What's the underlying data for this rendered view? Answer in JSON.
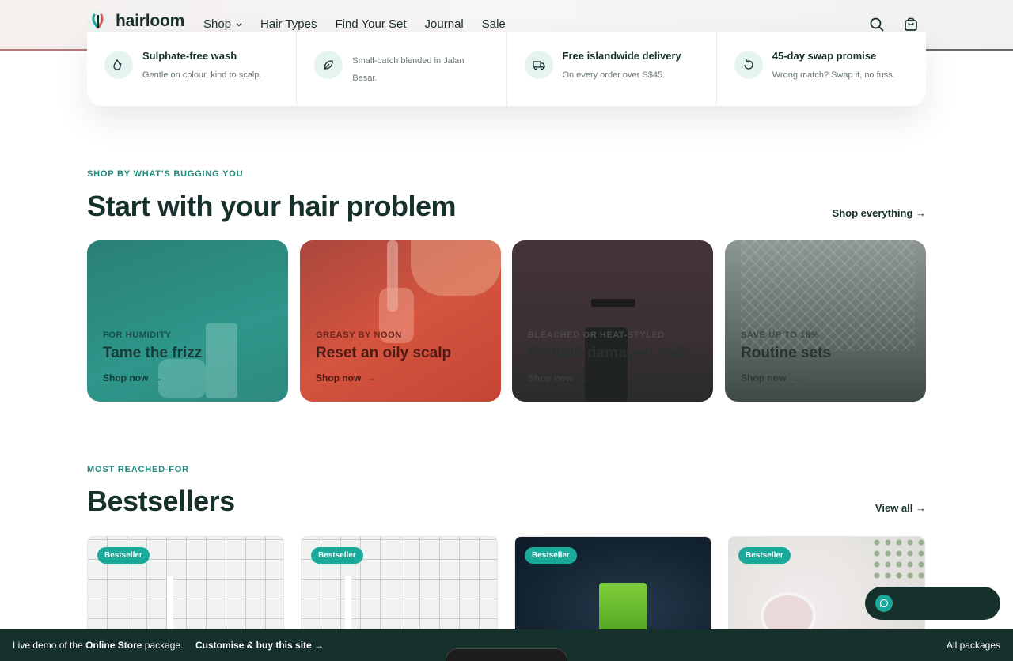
{
  "header": {
    "logo_text": "hairloom",
    "nav": [
      {
        "label": "Shop",
        "has_dropdown": true
      },
      {
        "label": "Hair Types",
        "has_dropdown": false
      },
      {
        "label": "Find Your Set",
        "has_dropdown": false
      },
      {
        "label": "Journal",
        "has_dropdown": false
      },
      {
        "label": "Sale",
        "has_dropdown": false
      }
    ],
    "icons": [
      "search-icon",
      "bag-icon"
    ]
  },
  "features": [
    {
      "icon": "droplet-icon",
      "title": "Sulphate-free wash",
      "text": "Gentle on colour, kind to scalp."
    },
    {
      "icon": "leaf-icon",
      "title": "",
      "text": "Small-batch blended in Jalan Besar."
    },
    {
      "icon": "truck-icon",
      "title": "Free islandwide delivery",
      "text": "On every order over S$45."
    },
    {
      "icon": "refresh-icon",
      "title": "45-day swap promise",
      "text": "Wrong match? Swap it, no fuss."
    }
  ],
  "problems_section": {
    "eyebrow": "SHOP BY WHAT'S BUGGING YOU",
    "title": "Start with your hair problem",
    "link": "Shop everything →",
    "cards": [
      {
        "overline": "FOR HUMIDITY",
        "title": "Tame the frizz",
        "cta": "Shop now",
        "color": "#2e8a80"
      },
      {
        "overline": "GREASY BY NOON",
        "title": "Reset an oily scalp",
        "cta": "Shop now",
        "color": "#d4503d"
      },
      {
        "overline": "BLEACHED OR HEAT-STYLED",
        "title": "Rebuild damaged ends",
        "cta": "Shop now",
        "color": "#3a3032"
      },
      {
        "overline": "SAVE UP TO 18%",
        "title": "Routine sets",
        "cta": "Shop now",
        "color": "#4b5a57"
      }
    ]
  },
  "bestsellers_section": {
    "eyebrow": "MOST REACHED-FOR",
    "title": "Bestsellers",
    "link": "View all →",
    "products": [
      {
        "badge": "Bestseller"
      },
      {
        "badge": "Bestseller"
      },
      {
        "badge": "Bestseller"
      },
      {
        "badge": "Bestseller"
      }
    ]
  },
  "chat": {
    "icon": "chat-icon"
  },
  "bottom_bar": {
    "prefix": "Live demo of the ",
    "package": "Online Store",
    "suffix": " package.",
    "cta": "Customise & buy this site →",
    "right": "All packages"
  },
  "colors": {
    "brand_dark": "#16302c",
    "accent": "#1aa99a",
    "eyebrow": "#1a8a7a"
  }
}
